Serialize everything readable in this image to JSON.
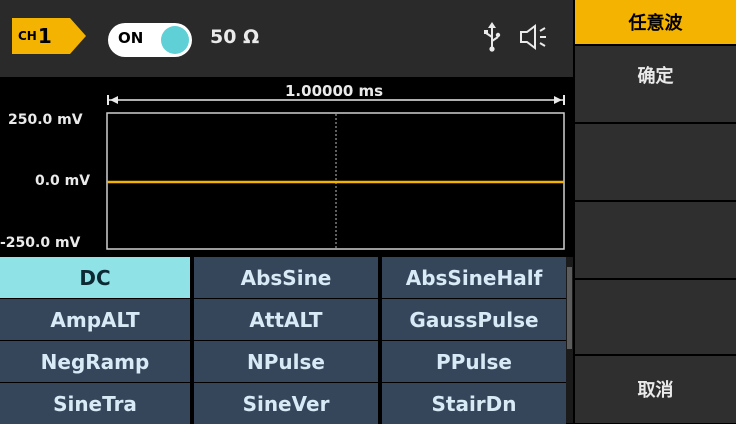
{
  "header": {
    "channel_prefix": "CH",
    "channel_number": "1",
    "output_toggle": "ON",
    "impedance": "50 Ω",
    "icons": [
      "usb-icon",
      "speaker-icon"
    ]
  },
  "waveform_preview": {
    "time_span": "1.00000 ms",
    "y_top": "250.0 mV",
    "y_mid": "0.0 mV",
    "y_bottom": "-250.0 mV",
    "trace_color": "#f3b300"
  },
  "wave_list": {
    "selected": "DC",
    "items": [
      "DC",
      "AbsSine",
      "AbsSineHalf",
      "AmpALT",
      "AttALT",
      "GaussPulse",
      "NegRamp",
      "NPulse",
      "PPulse",
      "SineTra",
      "SineVer",
      "StairDn"
    ]
  },
  "side_menu": {
    "title": "任意波",
    "confirm": "确定",
    "cancel": "取消"
  },
  "colors": {
    "accent": "#f3b300",
    "selected_bg": "#8fe2e6",
    "cell_bg": "#36465a"
  }
}
